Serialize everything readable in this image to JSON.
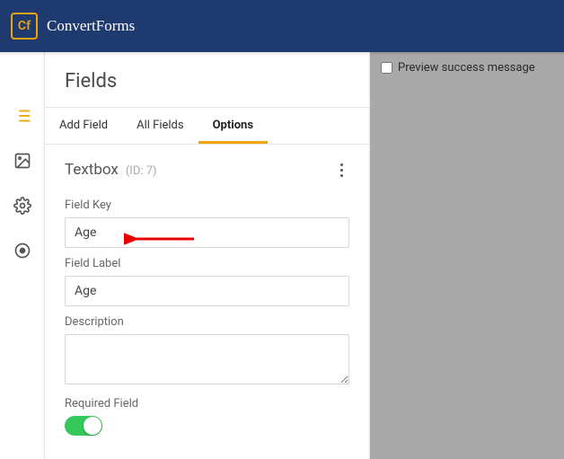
{
  "brand": {
    "logo_text": "Cf",
    "name": "ConvertForms"
  },
  "panel_title": "Fields",
  "tabs": {
    "add": "Add Field",
    "all": "All Fields",
    "options": "Options"
  },
  "current_field": {
    "type_label": "Textbox",
    "id_label": "(ID: 7)",
    "key_label": "Field Key",
    "key_value": "Age",
    "label_label": "Field Label",
    "label_value": "Age",
    "desc_label": "Description",
    "desc_value": "",
    "required_label": "Required Field"
  },
  "preview": {
    "checkbox_label": "Preview success message"
  }
}
